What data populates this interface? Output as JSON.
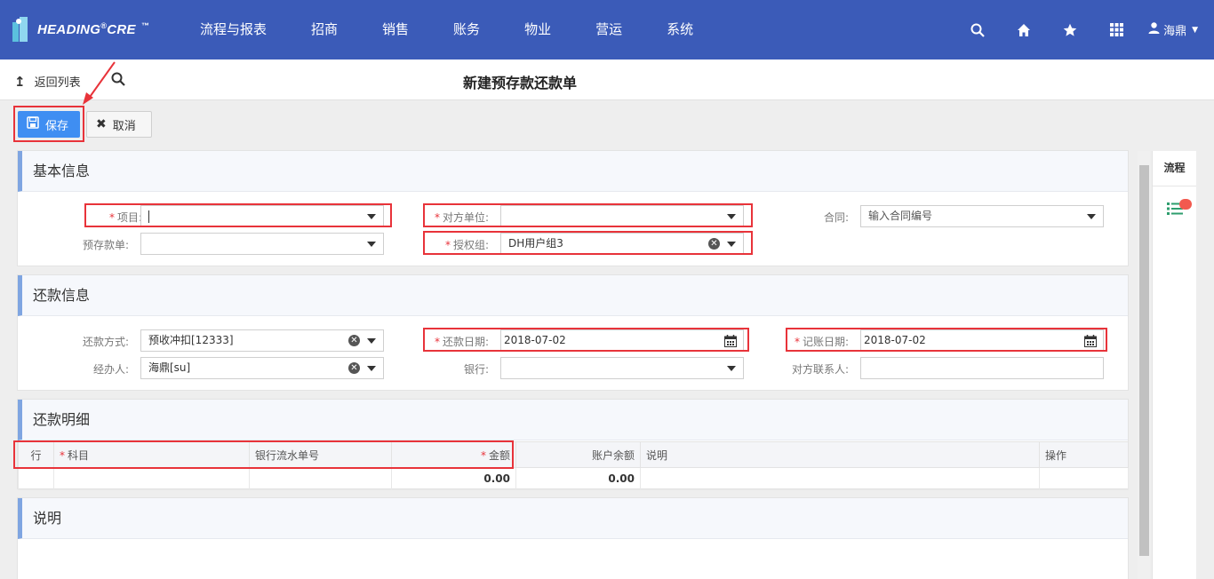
{
  "topbar": {
    "logo_text": "HEADING",
    "logo_reg": "®",
    "logo_text2": "CRE",
    "logo_tm": "™",
    "nav": [
      "流程与报表",
      "招商",
      "销售",
      "账务",
      "物业",
      "营运",
      "系统"
    ],
    "user_name": "海鼎",
    "icons": [
      "search-icon",
      "home-icon",
      "star-icon",
      "grid-icon",
      "user-icon"
    ]
  },
  "subbar": {
    "back_label": "返回列表",
    "title": "新建预存款还款单"
  },
  "toolbar": {
    "save_label": "保存",
    "cancel_label": "取消"
  },
  "basic": {
    "title": "基本信息",
    "project_label": "项目:",
    "project_value": "",
    "counterparty_label": "对方单位:",
    "counterparty_value": "",
    "contract_label": "合同:",
    "contract_placeholder": "输入合同编号",
    "prepay_label": "预存款单:",
    "prepay_value": "",
    "authgroup_label": "授权组:",
    "authgroup_value": "DH用户组3"
  },
  "repay": {
    "title": "还款信息",
    "method_label": "还款方式:",
    "method_value": "预收冲扣[12333]",
    "repay_date_label": "还款日期:",
    "repay_date_value": "2018-07-02",
    "book_date_label": "记账日期:",
    "book_date_value": "2018-07-02",
    "handler_label": "经办人:",
    "handler_value": "海鼎[su]",
    "bank_label": "银行:",
    "bank_value": "",
    "contact_label": "对方联系人:",
    "contact_value": ""
  },
  "detail": {
    "title": "还款明细",
    "columns": [
      "行",
      "科目",
      "银行流水单号",
      "金额",
      "账户余额",
      "说明",
      "操作"
    ],
    "totals": {
      "amount": "0.00",
      "balance": "0.00"
    }
  },
  "note": {
    "title": "说明"
  },
  "side": {
    "tab": "流程"
  },
  "colors": {
    "nav_bg": "#3b5bb8",
    "save_btn": "#3f8ef2",
    "highlight": "#e8333a",
    "required": "#e8333a"
  }
}
